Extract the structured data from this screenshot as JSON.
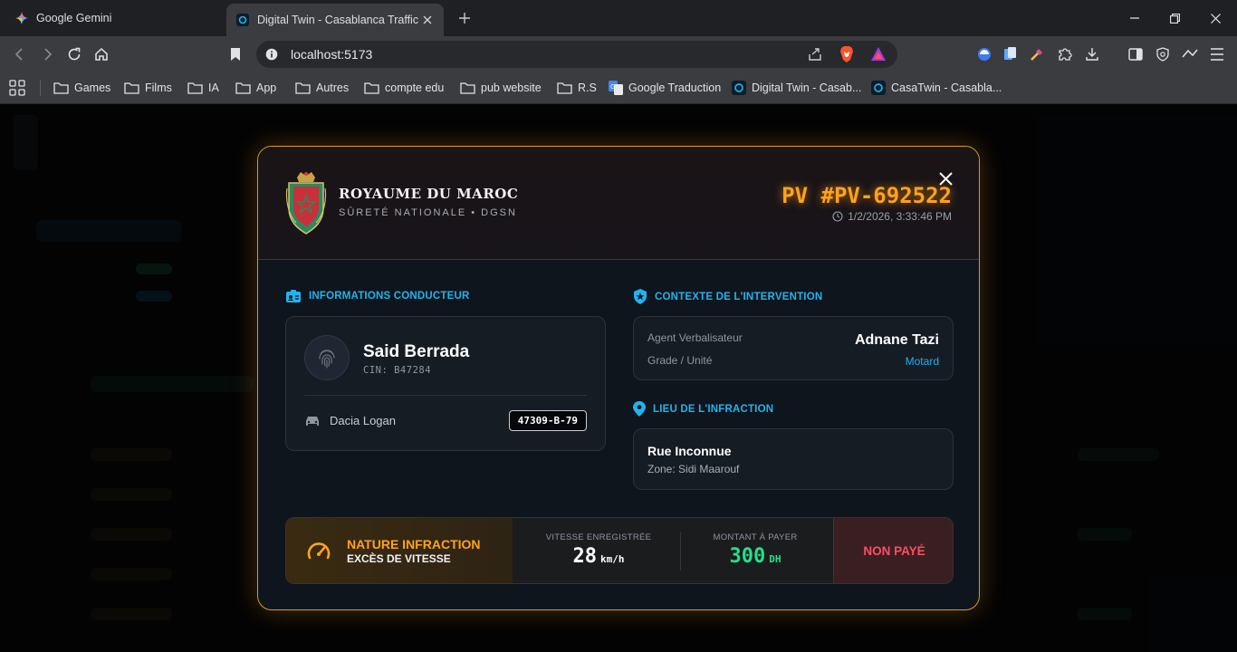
{
  "browser": {
    "tabs": [
      {
        "title": "Google Gemini",
        "active": false
      },
      {
        "title": "Digital Twin - Casablanca Traffic",
        "active": true
      }
    ],
    "url": "localhost:5173",
    "bookmarks": [
      "Games",
      "Films",
      "IA",
      "App",
      "Autres",
      "compte edu",
      "pub website",
      "R.S",
      "Google Traduction",
      "Digital Twin - Casab...",
      "CasaTwin - Casabla..."
    ]
  },
  "modal": {
    "kingdom": "ROYAUME DU MAROC",
    "agency": "SÛRETÉ NATIONALE • DGSN",
    "pv_number": "PV #PV-692522",
    "datetime": "1/2/2026, 3:33:46 PM",
    "driver_section": "INFORMATIONS CONDUCTEUR",
    "driver": {
      "name": "Said Berrada",
      "cin": "CIN: B47284",
      "vehicle": "Dacia Logan",
      "plate": "47309-B-79"
    },
    "context_section": "CONTEXTE DE L'INTERVENTION",
    "context": {
      "agent_label": "Agent Verbalisateur",
      "agent_name": "Adnane Tazi",
      "grade_label": "Grade / Unité",
      "grade_value": "Motard"
    },
    "location_section": "LIEU DE L'INFRACTION",
    "location": {
      "street": "Rue Inconnue",
      "zone": "Zone: Sidi Maarouf"
    },
    "infraction": {
      "title": "NATURE INFRACTION",
      "type": "EXCÈS DE VITESSE",
      "speed_label": "VITESSE ENREGISTRÉE",
      "speed_value": "28",
      "speed_unit": "km/h",
      "amount_label": "MONTANT À PAYER",
      "amount_value": "300",
      "amount_unit": "DH",
      "status": "NON PAYÉ"
    }
  },
  "colors": {
    "accent_orange": "#ffa31a",
    "accent_blue": "#1fb4f0",
    "paid_green": "#23e08a",
    "unpaid_red": "#ff4d63"
  }
}
